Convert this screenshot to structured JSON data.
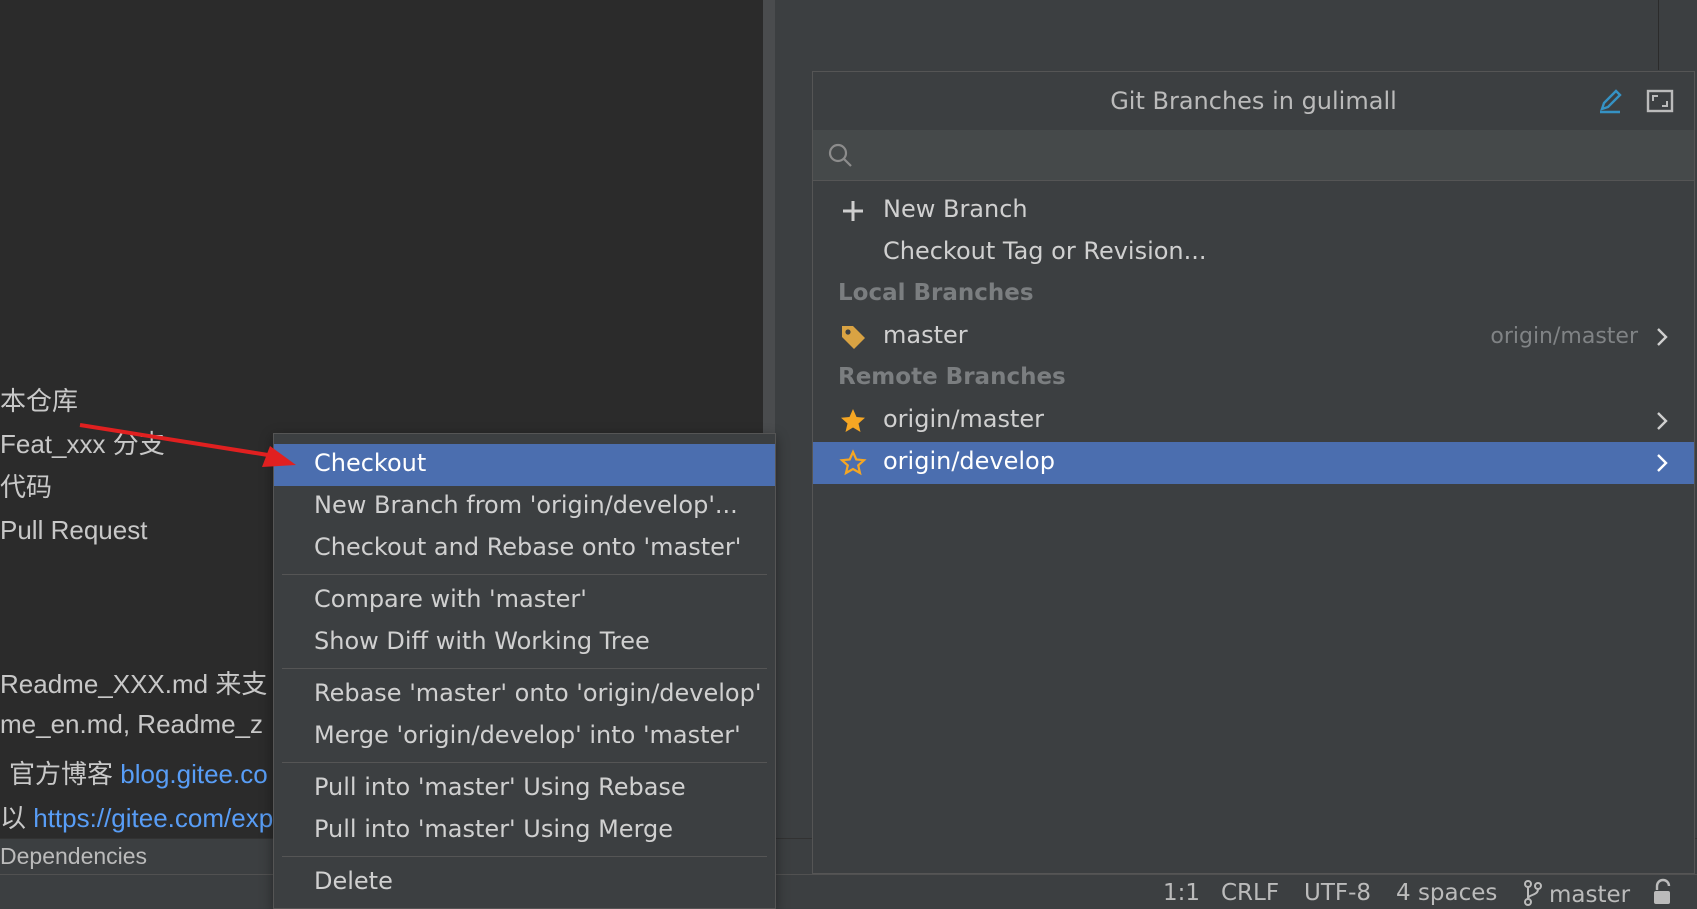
{
  "preview": {
    "lines": [
      "本仓库",
      "Feat_xxx 分支",
      "代码",
      "Pull Request",
      "Readme_XXX.md 来支",
      "me_en.md, Readme_z",
      "官方博客",
      "以"
    ],
    "links": [
      "blog.gitee.co",
      "https://gitee.com/exp"
    ]
  },
  "tool_strip": {
    "label": "Dependencies"
  },
  "branches_popup": {
    "title": "Git Branches in gulimall",
    "search": {
      "value": "",
      "placeholder": ""
    },
    "actions": [
      {
        "label": "New Branch",
        "icon": "plus-icon"
      },
      {
        "label": "Checkout Tag or Revision...",
        "icon": ""
      }
    ],
    "local_section": "Local Branches",
    "local_branches": [
      {
        "name": "master",
        "tracking": "origin/master",
        "icon": "tag-icon"
      }
    ],
    "remote_section": "Remote Branches",
    "remote_branches": [
      {
        "name": "origin/master",
        "icon": "star-filled-icon",
        "selected": false
      },
      {
        "name": "origin/develop",
        "icon": "star-outline-icon",
        "selected": true
      }
    ],
    "accent_color": "#4b6eaf",
    "icon_colors": {
      "tag": "#d9a343",
      "star": "#f5a623",
      "edit": "#3592c4"
    }
  },
  "context_menu": {
    "groups": [
      [
        "Checkout",
        "New Branch from 'origin/develop'...",
        "Checkout and Rebase onto 'master'"
      ],
      [
        "Compare with 'master'",
        "Show Diff with Working Tree"
      ],
      [
        "Rebase 'master' onto 'origin/develop'",
        "Merge 'origin/develop' into 'master'"
      ],
      [
        "Pull into 'master' Using Rebase",
        "Pull into 'master' Using Merge"
      ],
      [
        "Delete"
      ]
    ],
    "active_item": "Checkout"
  },
  "status_bar": {
    "position": "1:1",
    "line_separator": "CRLF",
    "encoding": "UTF-8",
    "indent": "4 spaces",
    "branch": "master"
  },
  "annotation_arrow_color": "#e02020"
}
